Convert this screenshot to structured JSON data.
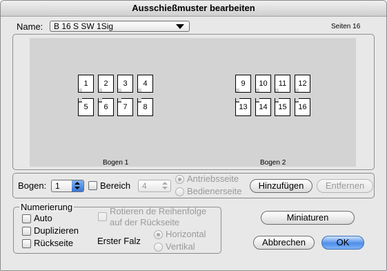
{
  "window": {
    "title": "Ausschießmuster bearbeiten"
  },
  "name_field": {
    "label": "Name:",
    "value": "B 16 S SW 1Sig"
  },
  "pages_info": "Seiten 16",
  "preview": {
    "sheets": [
      {
        "label": "Bogen 1",
        "top_row": [
          "1",
          "2",
          "3",
          "4"
        ],
        "bottom_row": [
          "5",
          "6",
          "7",
          "8"
        ]
      },
      {
        "label": "Bogen 2",
        "top_row": [
          "9",
          "10",
          "11",
          "12"
        ],
        "bottom_row": [
          "13",
          "14",
          "15",
          "16"
        ]
      }
    ]
  },
  "sheet_controls": {
    "bogen_label": "Bogen:",
    "bogen_value": "1",
    "bereich_label": "Bereich",
    "bereich_value": "4",
    "side_options": [
      "Antriebsseite",
      "Bedienerseite"
    ],
    "add_button": "Hinzufügen",
    "remove_button": "Entfernen"
  },
  "numbering": {
    "group_title": "Numerierung",
    "checkboxes": [
      "Auto",
      "Duplizieren",
      "Rückseite"
    ],
    "rotate_label_line1": "Rotieren de Reihenfolge",
    "rotate_label_line2": "auf der Rückseite",
    "first_fold_label": "Erster Falz",
    "fold_options": [
      "Horizontal",
      "Vertikal"
    ]
  },
  "buttons": {
    "thumbnails": "Miniaturen",
    "cancel": "Abbrechen",
    "ok": "OK"
  },
  "colors": {
    "preview_bg": "#d3d3d3",
    "default_button": "#4f8ee8"
  }
}
